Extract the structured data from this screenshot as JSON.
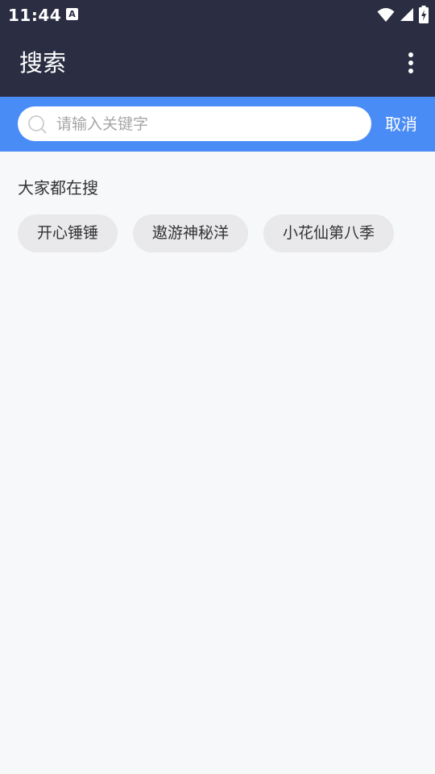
{
  "status_bar": {
    "time": "11:44",
    "notification_glyph": "A",
    "icons": [
      "wifi-icon",
      "cell-signal-icon",
      "battery-charging-icon"
    ]
  },
  "app_bar": {
    "title": "搜索",
    "more_icon": "more-vertical-icon"
  },
  "search": {
    "placeholder": "请输入关键字",
    "value": "",
    "cancel_label": "取消",
    "icon": "search-icon"
  },
  "popular": {
    "heading": "大家都在搜",
    "tags": [
      "开心锤锤",
      "遨游神秘洋",
      "小花仙第八季"
    ]
  },
  "colors": {
    "app_bar": "#2b2e43",
    "search_bar": "#4a8cf6",
    "background": "#f7f8fa",
    "tag_background": "#e9e9eb"
  }
}
